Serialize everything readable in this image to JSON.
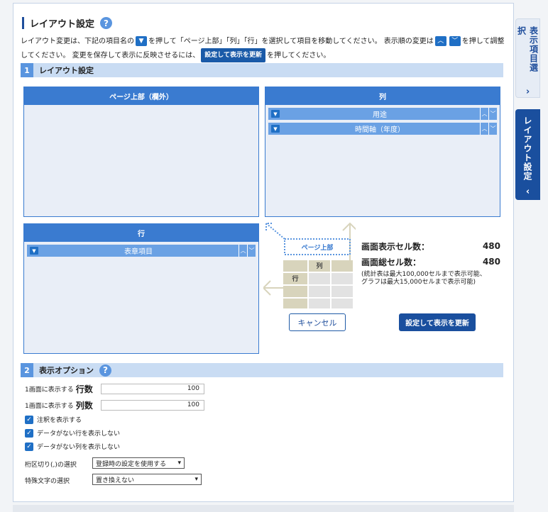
{
  "page": {
    "title": "レイアウト設定",
    "help_icon": "?",
    "desc_1": "レイアウト変更は、下記の項目名の",
    "desc_2": "を押して「ページ上部」「列」「行」を選択して項目を移動してください。 表示順の変更は",
    "desc_3": "を押して調整してください。 変更を保存して表示に反映させるには、",
    "desc_4": "を押してください。",
    "desc_btn": "設定して表示を更新"
  },
  "section1": {
    "num": "1",
    "title": "レイアウト設定"
  },
  "page_area": {
    "title": "ページ上部（欄外）"
  },
  "columns_area": {
    "title": "列",
    "items": [
      {
        "label": "用途"
      },
      {
        "label": "時間軸（年度）"
      }
    ]
  },
  "rows_area": {
    "title": "行",
    "items": [
      {
        "label": "表章項目"
      }
    ]
  },
  "diagram": {
    "page_label": "ページ上部",
    "col_label": "列",
    "row_label": "行"
  },
  "stats": {
    "display_cells_label": "画面表示セル数：",
    "display_cells_value": "480",
    "total_cells_label": "画面総セル数：",
    "total_cells_value": "480",
    "note_1": "(統計表は最大100,000セルまで表示可能、",
    "note_2": "グラフは最大15,000セルまで表示可能)"
  },
  "buttons": {
    "cancel": "キャンセル",
    "apply": "設定して表示を更新"
  },
  "section2": {
    "num": "2",
    "title": "表示オプション",
    "help_icon": "?"
  },
  "options": {
    "rows_prefix": "1画面に表示する",
    "rows_label": "行数",
    "rows_value": "100",
    "cols_prefix": "1画面に表示する",
    "cols_label": "列数",
    "cols_value": "100",
    "check_notes": "注釈を表示する",
    "check_empty_rows": "データがない行を表示しない",
    "check_empty_cols": "データがない列を表示しない",
    "separator_label": "桁区切り(,)の選択",
    "separator_value": "登録時の設定を使用する",
    "special_label": "特殊文字の選択",
    "special_value": "置き換えない"
  },
  "side_tabs": {
    "items_tab": "表示項目選択",
    "layout_tab": "レイアウト設定"
  },
  "colors": {
    "accent": "#1a4f9e",
    "panel_head": "#3a7bd0",
    "chip": "#6aa1e4",
    "section_bg": "#c9dcf3"
  }
}
